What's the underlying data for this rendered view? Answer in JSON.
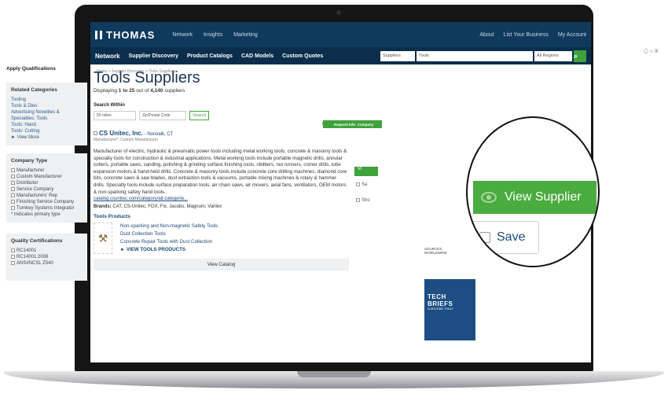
{
  "header": {
    "logo": "THOMAS",
    "nav": [
      "Network",
      "Insights",
      "Marketing"
    ],
    "right": [
      "About",
      "List Your Business",
      "My Account"
    ]
  },
  "navbar": {
    "network": "Network",
    "items": [
      "Supplier Discovery",
      "Product Catalogs",
      "CAD Models",
      "Custom Quotes"
    ],
    "search_type": "Suppliers",
    "search_query": "Tools",
    "region": "All Regions"
  },
  "breadcrumb": "Home > Supplier Discovery > Tools Suppliers",
  "sidebar": {
    "heading": "Apply Qualifications",
    "related": {
      "title": "Related Categories",
      "items": [
        "Tooling",
        "Tools & Dies",
        "Advertising Novelties & Specialties: Tools",
        "Tools: Hand",
        "Tools: Cutting",
        "► View More"
      ]
    },
    "company_type": {
      "title": "Company Type",
      "items": [
        "Manufacturer",
        "Custom Manufacturer",
        "Distributor",
        "Service Company",
        "Manufacturers' Rep",
        "Finishing Service Company",
        "Turnkey Systems Integrator"
      ],
      "note": "* Indicates primary type"
    },
    "quality": {
      "title": "Quality Certifications",
      "items": [
        "RC14001",
        "RC14001:2008",
        "ANSI/NCSL Z540"
      ]
    }
  },
  "main": {
    "title": "Tools Suppliers",
    "count_pre": "Displaying ",
    "count_range": "1 to 25",
    "count_mid": " out of ",
    "count_total": "4,140",
    "count_post": " suppliers",
    "search_within": "Search Within",
    "miles": "50 miles",
    "zip_placeholder": "Zip/Postal Code",
    "search_btn": "Search"
  },
  "card": {
    "name": "CS Unitec, Inc.",
    "location": " - Norwalk, CT",
    "type": "Manufacturer*, Custom Manufacturer",
    "description": "Manufacturer of electric, hydraulic & pneumatic power tools including metal working tools, concrete & masonry tools & specialty tools for construction & industrial applications. Metal working tools include portable magnetic drills, annular cutters, portable saws, sanding, polishing & grinding surface finishing tools, nibblers, nut runners, corner drills, tube expansion motors & hand-held drills. Concrete & masonry tools include concrete core drilling machines, diamond core bits, concrete saws & saw blades, dust extraction tools & vacuums, portable mixing machines & rotary & hammer drills. Specialty tools include surface preparation tools, air chain saws, air movers, axial fans, ventilators, OEM motors & non-sparking safety hand tools.",
    "url": "catalog.csunitec.com/category/all-categorie...",
    "brands_label": "Brands: ",
    "brands": "CAT, CS-Unitec, FOX, Fix, Jacobs, Magnum, Varilex",
    "products_title": "Tools Products",
    "products": [
      "Non-sparking and Non-magnetic Safety Tools",
      "Dust Collection Tools",
      "Concrete Repair Tools with Dust Collection"
    ],
    "view_products": "► VIEW TOOLS PRODUCTS",
    "view_catalog": "View Catalog"
  },
  "right": {
    "request_info": "Request Info",
    "company": "Company",
    "small_view": "Vi",
    "small_s1": "Sa",
    "small_s2": "Sho",
    "ad_text1": "SOURCES,",
    "ad_text2": "WORLDWIDE",
    "ad_title": "TECH BRIEFS",
    "ad_sub": "SUBSCRIBE TODAY"
  },
  "magnifier": {
    "view_supplier": "View Supplier",
    "save": "Save"
  }
}
